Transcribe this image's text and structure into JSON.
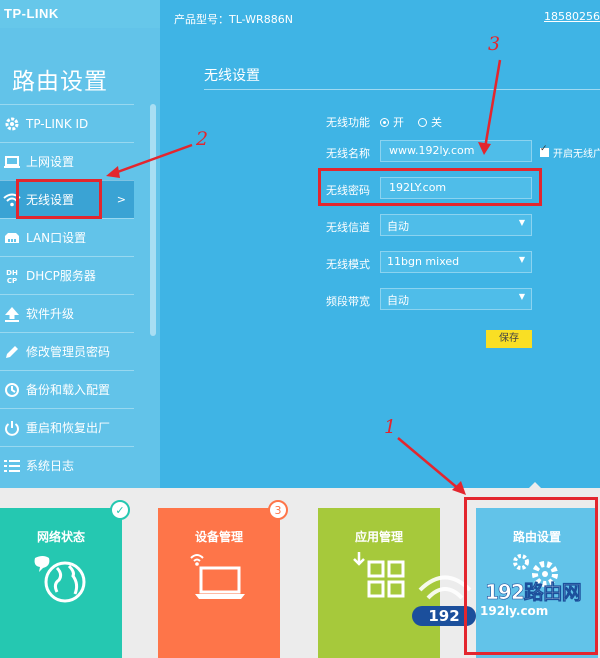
{
  "brand": {
    "logo": "TP-LINK"
  },
  "header": {
    "model": "产品型号：TL-WR886N",
    "phone": "18580256"
  },
  "sidebar": {
    "title": "路由设置",
    "items": [
      {
        "label": "TP-LINK ID",
        "icon": "gear-icon"
      },
      {
        "label": "上网设置",
        "icon": "monitor-icon"
      },
      {
        "label": "无线设置",
        "icon": "wifi-icon",
        "active": true,
        "chevron": ">"
      },
      {
        "label": "LAN口设置",
        "icon": "lan-icon"
      },
      {
        "label": "DHCP服务器",
        "icon": "dhcp-icon",
        "icon_text": "DHCP"
      },
      {
        "label": "软件升级",
        "icon": "upload-icon"
      },
      {
        "label": "修改管理员密码",
        "icon": "pencil-icon"
      },
      {
        "label": "备份和载入配置",
        "icon": "backup-icon"
      },
      {
        "label": "重启和恢复出厂",
        "icon": "power-icon"
      },
      {
        "label": "系统日志",
        "icon": "list-icon"
      }
    ]
  },
  "main": {
    "title": "无线设置",
    "wireless_function": {
      "label": "无线功能",
      "on": "开",
      "off": "关"
    },
    "ssid": {
      "label": "无线名称",
      "value": "www.192ly.com",
      "hide_label": "开启无线广"
    },
    "password": {
      "label": "无线密码",
      "value": "192LY.com"
    },
    "channel": {
      "label": "无线信道",
      "value": "自动"
    },
    "mode": {
      "label": "无线模式",
      "value": "11bgn mixed"
    },
    "bandwidth": {
      "label": "频段带宽",
      "value": "自动"
    },
    "save_label": "保存"
  },
  "tiles": {
    "network": {
      "label": "网络状态"
    },
    "device": {
      "label": "设备管理",
      "badge": "3"
    },
    "app": {
      "label": "应用管理"
    },
    "route": {
      "label": "路由设置"
    }
  },
  "watermark": {
    "brand": "192路由网",
    "number": "192",
    "url": "192ly.com"
  },
  "annotations": {
    "one": "1",
    "two": "2",
    "three": "3"
  },
  "colors": {
    "sidebar": "#62c3e9",
    "main": "#3fb4e5",
    "save": "#f9df24",
    "annotation": "#e3262e",
    "tile_network": "#25c8b1",
    "tile_device": "#fe7549",
    "tile_app": "#a6c93b",
    "tile_route": "#62c3e9"
  }
}
